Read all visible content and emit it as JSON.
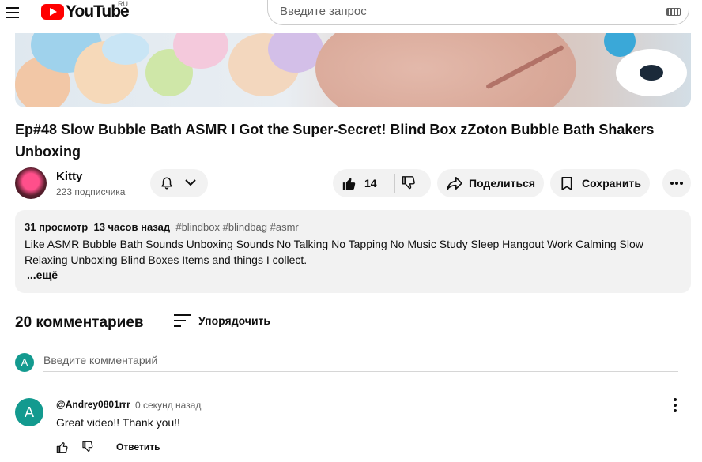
{
  "header": {
    "logo_text": "YouTube",
    "region": "RU",
    "search_placeholder": "Введите запрос"
  },
  "video": {
    "title": "Ep#48 Slow Bubble Bath ASMR I Got the Super-Secret! Blind Box zZoton Bubble Bath Shakers Unboxing",
    "channel": "Kitty",
    "subscribers": "223 подписчика",
    "likes": "14",
    "share_label": "Поделиться",
    "save_label": "Сохранить"
  },
  "description": {
    "views": "31 просмотр",
    "time": "13 часов назад",
    "tags": "#blindbox #blindbag #asmr",
    "text": "Like ASMR Bubble Bath Sounds Unboxing Sounds No Talking No Tapping No Music Study Sleep Hangout Work Calming Slow Relaxing Unboxing Blind Boxes Items and things I collect.",
    "more": "...ещё"
  },
  "comments": {
    "count_label": "20 комментариев",
    "sort_label": "Упорядочить",
    "input_placeholder": "Введите комментарий",
    "self_avatar_letter": "A",
    "items": [
      {
        "avatar_letter": "A",
        "author": "@Andrey0801rrr",
        "time": "0 секунд назад",
        "text": "Great video!! Thank you!!",
        "reply_label": "Ответить"
      }
    ]
  },
  "icons": {
    "menu": "menu-icon",
    "bell": "bell-icon",
    "like": "thumbs-up-icon",
    "dislike": "thumbs-down-icon",
    "share": "share-icon",
    "save": "bookmark-icon",
    "more": "more-horizontal-icon",
    "sort": "sort-icon",
    "keyboard": "keyboard-icon"
  },
  "colors": {
    "brand_red": "#ff0000",
    "avatar_teal": "#139a8f",
    "pill_bg": "#f2f2f2"
  }
}
